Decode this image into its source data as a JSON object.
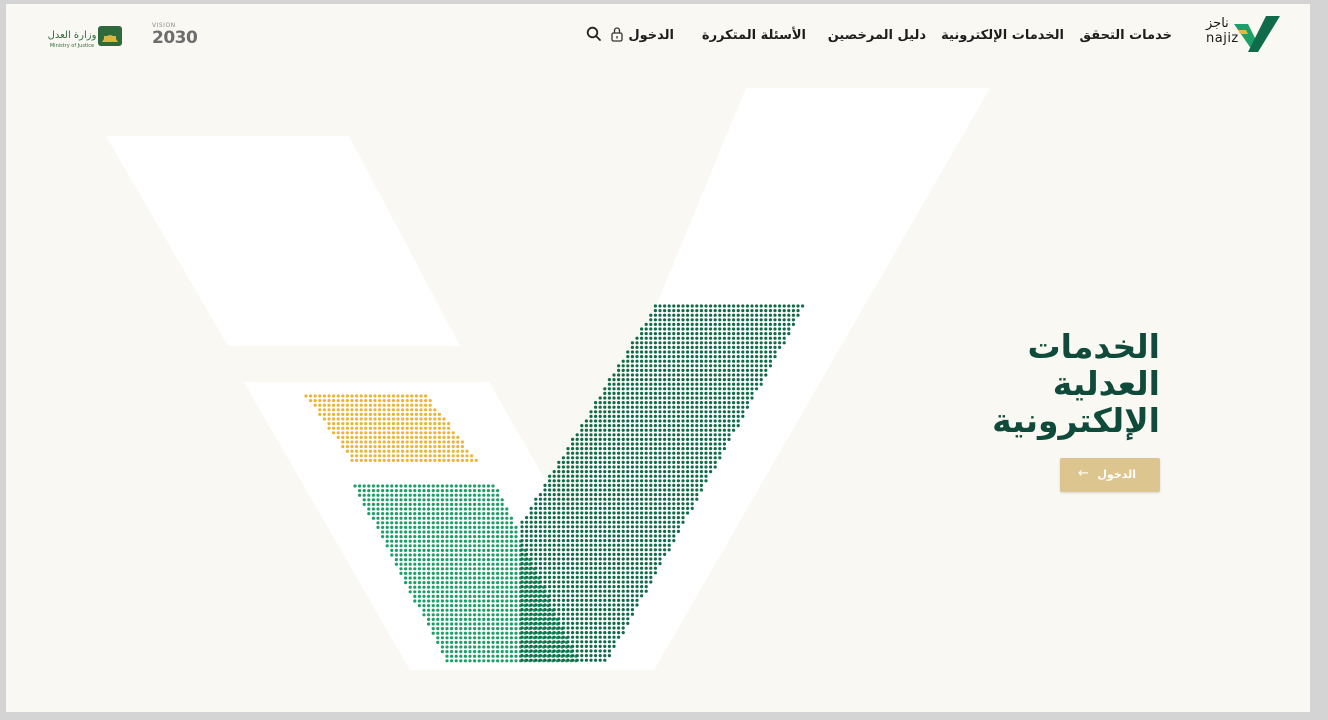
{
  "brand": {
    "name_ar": "ناجز",
    "name_en": "najiz"
  },
  "nav": {
    "items": [
      {
        "label": "خدمات التحقق"
      },
      {
        "label": "الخدمات الإلكترونية"
      },
      {
        "label": "دليل المرخصين"
      },
      {
        "label": "الأسئلة المتكررة"
      }
    ],
    "login_label": "الدخول"
  },
  "partners": {
    "vision_small": "VISION",
    "vision_year": "2030",
    "ministry_en": "Ministry of Justice",
    "ministry_ar": "وزارة العدل"
  },
  "hero": {
    "lines": [
      "الخدمات",
      "العدلية",
      "الإلكترونية"
    ],
    "cta_label": "الدخول"
  },
  "colors": {
    "dark_green": "#0f6b49",
    "green": "#1ca068",
    "gold": "#eab63a",
    "heading": "#0f4a3a",
    "button": "#dcc58e",
    "background": "#f9f8f3"
  },
  "icons": {
    "search": "search-icon",
    "lock": "lock-icon",
    "arrow": "arrow-left-icon"
  }
}
